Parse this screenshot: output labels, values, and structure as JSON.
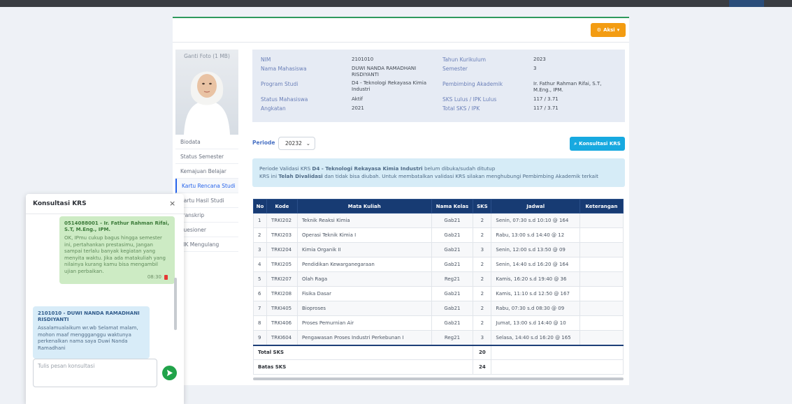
{
  "header": {
    "action_label": "Aksi"
  },
  "photo": {
    "label": "Ganti Foto (1 MB)"
  },
  "sidemenu": [
    {
      "label": "Biodata",
      "active": false
    },
    {
      "label": "Status Semester",
      "active": false
    },
    {
      "label": "Kemajuan Belajar",
      "active": false
    },
    {
      "label": "Kartu Rencana Studi",
      "active": true
    },
    {
      "label": "Kartu Hasil Studi",
      "active": false
    },
    {
      "label": "Transkrip",
      "active": false
    },
    {
      "label": "Kuesioner",
      "active": false
    },
    {
      "label": "MK Mengulang",
      "active": false
    }
  ],
  "student": {
    "nim_label": "NIM",
    "nim": "2101010",
    "nama_label": "Nama Mahasiswa",
    "nama": "DUWI NANDA RAMADHANI RISDIYANTI",
    "prodi_label": "Program Studi",
    "prodi": "D4 - Teknologi Rekayasa Kimia Industri",
    "status_label": "Status Mahasiswa",
    "status": "Aktif",
    "angkatan_label": "Angkatan",
    "angkatan": "2021",
    "kurikulum_label": "Tahun Kurikulum",
    "kurikulum": "2023",
    "semester_label": "Semester",
    "semester": "3",
    "pembimbing_label": "Pembimbing Akademik",
    "pembimbing": "Ir. Fathur Rahman Rifai, S.T, M.Eng., IPM.",
    "sks_lulus_label": "SKS Lulus / IPK Lulus",
    "sks_lulus": "117 / 3.71",
    "total_sks_label": "Total SKS / IPK",
    "total_sks": "117 / 3.71"
  },
  "periode": {
    "label": "Periode",
    "value": "20232"
  },
  "konsultasi_button": "Konsultasi KRS",
  "alert": {
    "line1_pre": "Periode Validasi KRS ",
    "line1_bold": "D4 - Teknologi Rekayasa Kimia Industri",
    "line1_post": " belum dibuka/sudah ditutup",
    "line2_pre": "KRS ini ",
    "line2_bold": "Telah Divalidasi",
    "line2_post": " dan tidak bisa diubah. Untuk membatalkan validasi KRS silakan menghubungi Pembimbing Akademik terkait"
  },
  "table": {
    "headers": [
      "No",
      "Kode",
      "Mata Kuliah",
      "Nama Kelas",
      "SKS",
      "Jadwal",
      "Keterangan"
    ],
    "rows": [
      [
        "1",
        "TRKI202",
        "Teknik Reaksi Kimia",
        "Gab21",
        "2",
        "Senin, 07:30 s.d 10:10 @ 164",
        ""
      ],
      [
        "2",
        "TRKI203",
        "Operasi Teknik Kimia I",
        "Gab21",
        "2",
        "Rabu, 13:00 s.d 14:40 @ 12",
        ""
      ],
      [
        "3",
        "TRKI204",
        "Kimia Organik II",
        "Gab21",
        "3",
        "Senin, 12:00 s.d 13:50 @ 09",
        ""
      ],
      [
        "4",
        "TRKI205",
        "Pendidikan Kewarganegaraan",
        "Gab21",
        "2",
        "Senin, 14:40 s.d 16:20 @ 164",
        ""
      ],
      [
        "5",
        "TRKI207",
        "Olah Raga",
        "Reg21",
        "2",
        "Kamis, 16:20 s.d 19:40 @ 36",
        ""
      ],
      [
        "6",
        "TRKI208",
        "Fisika Dasar",
        "Gab21",
        "2",
        "Kamis, 11:10 s.d 12:50 @ 167",
        ""
      ],
      [
        "7",
        "TRKI405",
        "Bioproses",
        "Gab21",
        "2",
        "Rabu, 07:30 s.d 08:30 @ 09",
        ""
      ],
      [
        "8",
        "TRKI406",
        "Proses Pemurnian Air",
        "Gab21",
        "2",
        "Jumat, 13:00 s.d 14:40 @ 10",
        ""
      ],
      [
        "9",
        "TRKI604",
        "Pengawasan Proses Industri Perkebunan I",
        "Reg21",
        "3",
        "Selasa, 14:40 s.d 16:20 @ 165",
        ""
      ]
    ],
    "total_label": "Total SKS",
    "total_value": "20",
    "batas_label": "Batas SKS",
    "batas_value": "24"
  },
  "chat": {
    "title": "Konsultasi KRS",
    "messages": [
      {
        "sender": "0514088001 - Ir. Fathur Rahman Rifai, S.T, M.Eng., IPM.",
        "text": "OK, IPmu cukup bagus hingga semester ini, pertahankan prestasimu, Jangan sampai terlalu banyak kegiatan yang menyita waktu. Jika ada matakuliah yang nilainya kurang kamu bisa mengambil ujian perbaikan.",
        "time": "08:30"
      },
      {
        "sender": "2101010 - DUWI NANDA RAMADHANI RISDIYANTI",
        "text": "Assalamualaikum wr.wb Selamat malam, mohon maaf menggganggu waktunya perkenalkan nama saya Duwi Nanda Ramadhani"
      }
    ],
    "input_placeholder": "Tulis pesan konsultasi"
  },
  "colors": {
    "primary": "#173b73",
    "accent_green": "#2e9a5c",
    "warning": "#f39c12",
    "info": "#17a9e0"
  }
}
